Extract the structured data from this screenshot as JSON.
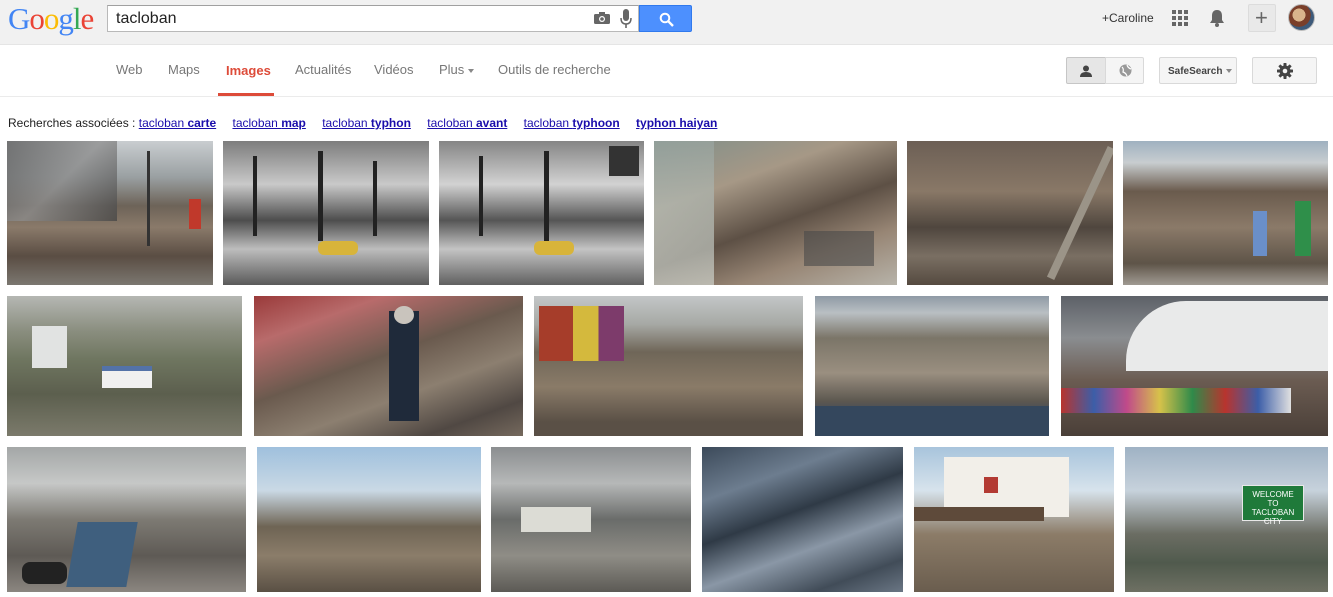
{
  "logo": {
    "letters": [
      {
        "ch": "G",
        "color": "#4285f4"
      },
      {
        "ch": "o",
        "color": "#ea4335"
      },
      {
        "ch": "o",
        "color": "#fbbc05"
      },
      {
        "ch": "g",
        "color": "#4285f4"
      },
      {
        "ch": "l",
        "color": "#34a853"
      },
      {
        "ch": "e",
        "color": "#ea4335"
      }
    ]
  },
  "search": {
    "query": "tacloban"
  },
  "user": {
    "name": "+Caroline"
  },
  "nav": {
    "web": "Web",
    "maps": "Maps",
    "images": "Images",
    "news": "Actualités",
    "videos": "Vidéos",
    "more": "Plus",
    "tools": "Outils de recherche"
  },
  "safesearch": {
    "label": "SafeSearch"
  },
  "related": {
    "prefix": "Recherches associées :",
    "items": [
      {
        "plain": "tacloban ",
        "bold": "carte"
      },
      {
        "plain": "tacloban ",
        "bold": "map"
      },
      {
        "plain": "tacloban ",
        "bold": "typhon"
      },
      {
        "plain": "tacloban ",
        "bold": "avant"
      },
      {
        "plain": "tacloban ",
        "bold": "typhoon"
      },
      {
        "plain": "",
        "bold": "typhon haiyan"
      }
    ]
  },
  "sign": {
    "line1": "WELCOME",
    "line2": "TO",
    "line3": "TACLOBAN CITY"
  },
  "colors": {
    "accent": "#dd4b39",
    "button_blue": "#4d90fe",
    "link": "#1a0dab"
  }
}
